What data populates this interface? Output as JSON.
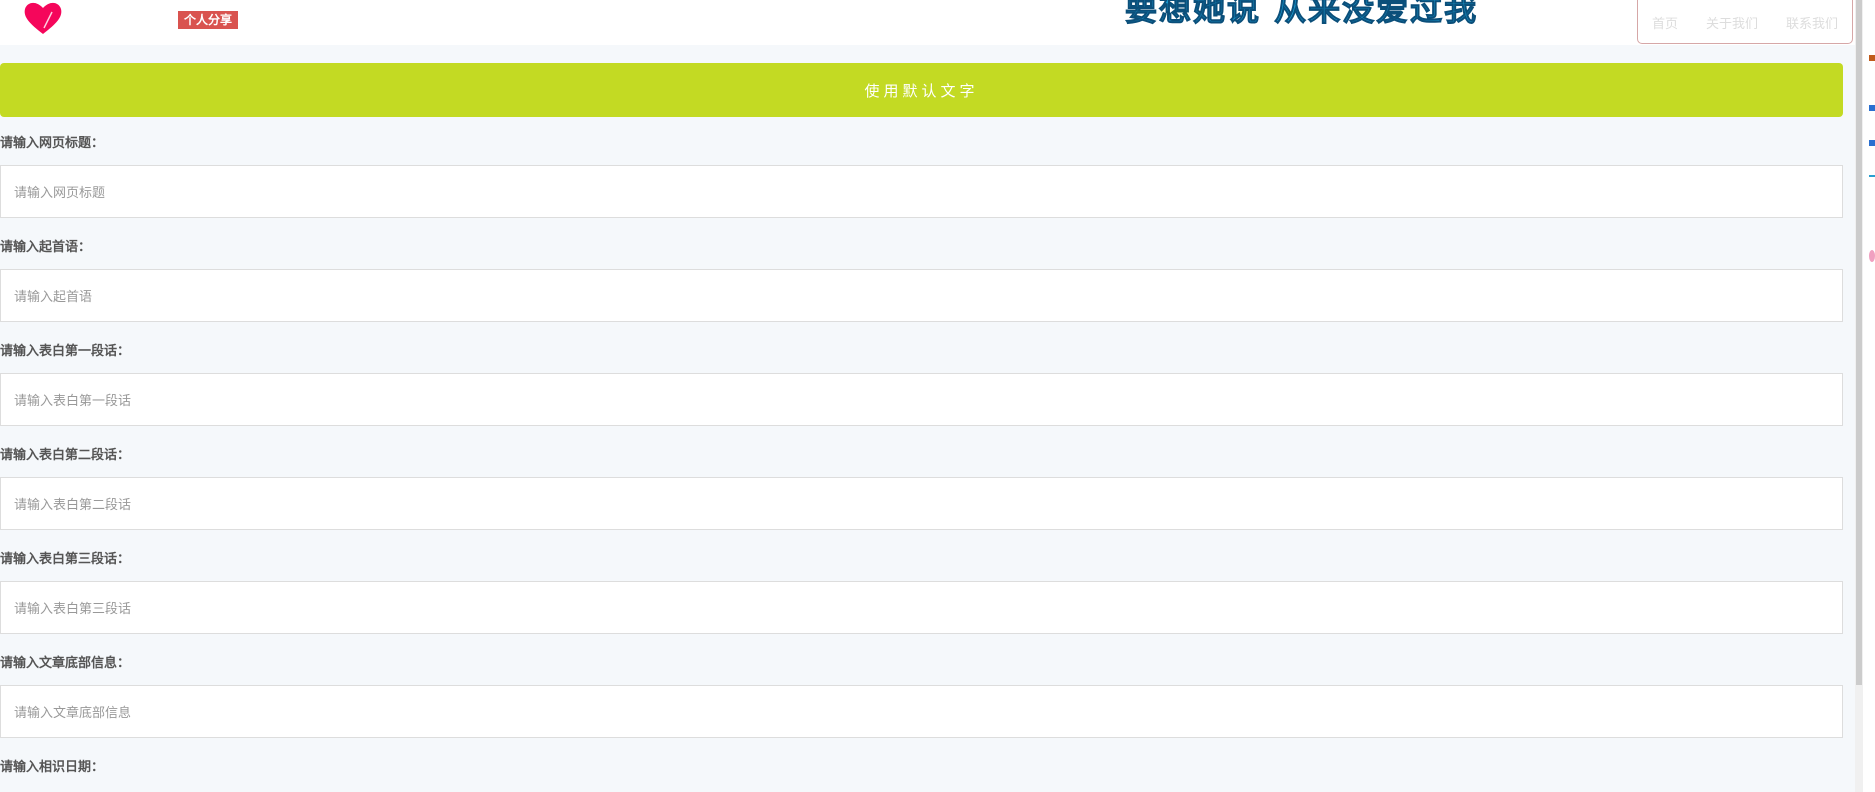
{
  "header": {
    "badge": "个人分享",
    "title": "要想她说 从来没爱过我",
    "nav": [
      "首页",
      "关于我们",
      "联系我们"
    ]
  },
  "button": {
    "label": "使用默认文字"
  },
  "fields": [
    {
      "label": "请输入网页标题：",
      "placeholder": "请输入网页标题"
    },
    {
      "label": "请输入起首语：",
      "placeholder": "请输入起首语"
    },
    {
      "label": "请输入表白第一段话：",
      "placeholder": "请输入表白第一段话"
    },
    {
      "label": "请输入表白第二段话：",
      "placeholder": "请输入表白第二段话"
    },
    {
      "label": "请输入表白第三段话：",
      "placeholder": "请输入表白第三段话"
    },
    {
      "label": "请输入文章底部信息：",
      "placeholder": "请输入文章底部信息"
    },
    {
      "label": "请输入相识日期："
    }
  ],
  "colors": {
    "accent": "#c3da23",
    "badge": "#d9534f",
    "title": "#1aa0d8"
  }
}
